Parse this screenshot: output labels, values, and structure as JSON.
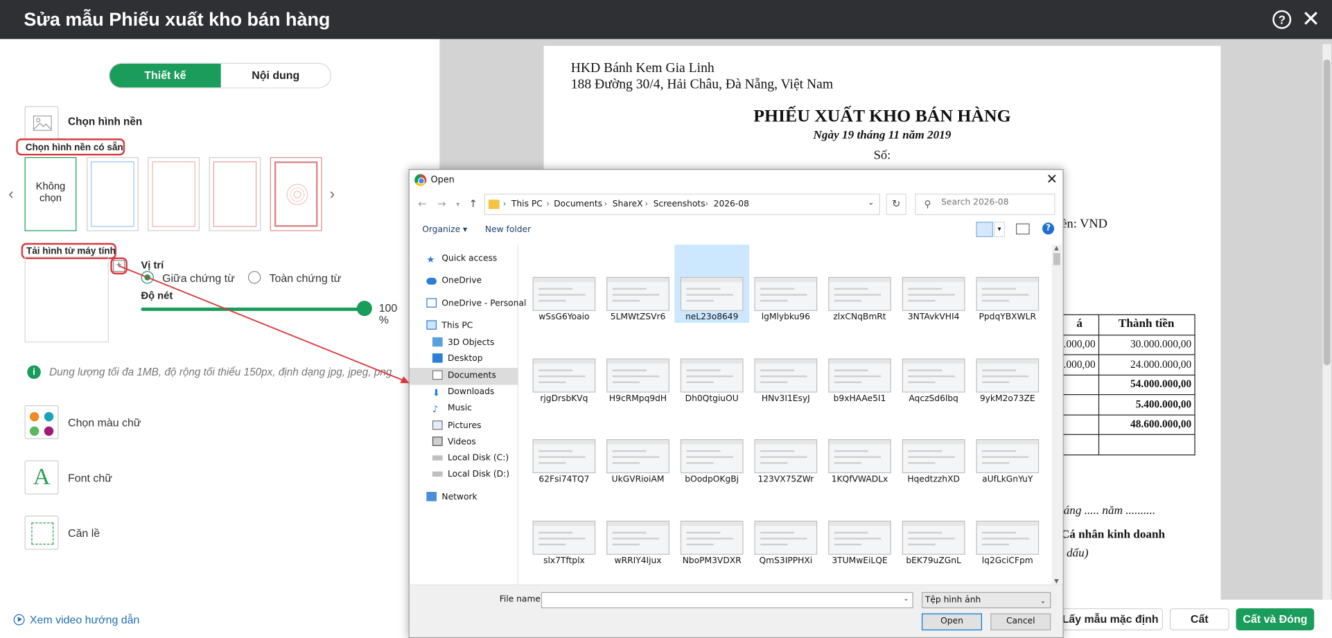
{
  "window": {
    "title": "Sửa mẫu Phiếu xuất kho bán hàng",
    "help_icon": "?",
    "close_icon": "✕"
  },
  "left_panel": {
    "tabs": [
      "Thiết kế",
      "Nội dung"
    ],
    "choose_background": "Chọn hình nền",
    "preset_label": "Chọn hình nền có sẵn",
    "none_label": "Không chọn",
    "upload_label": "Tải hình từ máy tính",
    "position_label": "Vị trí",
    "position_options": [
      "Giữa chứng từ",
      "Toàn chứng từ"
    ],
    "opacity_label": "Độ nét",
    "opacity_value": "100",
    "opacity_unit": "%",
    "opacity_level": 1.0,
    "info": "Dung lượng tối đa 1MB, độ rộng tối thiểu 150px, định dạng jpg, jpeg, png",
    "tools": [
      "Chọn màu chữ",
      "Font chữ",
      "Căn lề"
    ],
    "video_link": "Xem video hướng dẫn"
  },
  "document": {
    "company": "HKD Bánh Kem Gia Linh",
    "address": "188 Đường 30/4, Hải Châu, Đà Nẵng, Việt Nam",
    "title": "PHIẾU XUẤT KHO BÁN HÀNG",
    "date": "Ngày 19 tháng 11 năm 2019",
    "number_label": "Số:",
    "currency": "tiền: VND",
    "table_header": [
      "á",
      "Thành tiền"
    ],
    "rows": [
      [
        ".000,00",
        "30.000.000,00"
      ],
      [
        ".000,00",
        "24.000.000,00"
      ],
      [
        "",
        "54.000.000,00"
      ],
      [
        "",
        "5.400.000,00"
      ],
      [
        "",
        "48.600.000,00"
      ],
      [
        "",
        ""
      ]
    ],
    "sig_date": "háng ..... năm ..........",
    "sig_role": "/Cá nhân kinh doanh",
    "sig_note": "g dấu)"
  },
  "buttons": {
    "default_template": "Lấy mẫu mặc định",
    "save": "Cất",
    "save_close": "Cất và Đóng"
  },
  "dialog": {
    "title": "Open",
    "breadcrumb": [
      "This PC",
      "Documents",
      "ShareX",
      "Screenshots",
      "2026-08"
    ],
    "search_placeholder": "Search 2026-08",
    "organize": "Organize",
    "new_folder": "New folder",
    "nav_items": [
      "Quick access",
      "OneDrive",
      "OneDrive - Personal",
      "This PC",
      "3D Objects",
      "Desktop",
      "Documents",
      "Downloads",
      "Music",
      "Pictures",
      "Videos",
      "Local Disk (C:)",
      "Local Disk (D:)",
      "Network"
    ],
    "files": [
      "wSsG6Yoaio",
      "5LMWtZSVr6",
      "neL23o8649",
      "lgMlybku96",
      "zlxCNqBmRt",
      "3NTAvkVHI4",
      "PpdqYBXWLR",
      "rjgDrsbKVq",
      "H9cRMpq9dH",
      "Dh0QtgiuOU",
      "HNv3I1EsyJ",
      "b9xHAAe5I1",
      "AqczSd6lbq",
      "9ykM2o73ZE",
      "62Fsi74TQ7",
      "UkGVRioiAM",
      "bOodpOKgBj",
      "123VX75ZWr",
      "1KQfVWADLx",
      "HqedtzzhXD",
      "aUfLkGnYuY",
      "slx7Tftplx",
      "wRRIY4Ijux",
      "NboPM3VDXR",
      "QmS3IPPHXi",
      "3TUMwEiLQE",
      "bEK79uZGnL",
      "lq2GciCFpm"
    ],
    "file_name_label": "File name:",
    "file_name_value": "",
    "file_type": "Tệp hình ảnh",
    "open": "Open",
    "cancel": "Cancel"
  }
}
